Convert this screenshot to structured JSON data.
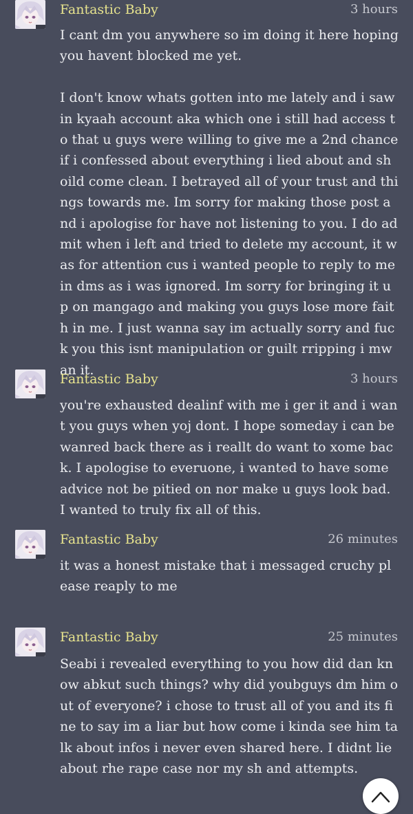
{
  "comments": [
    {
      "user": "Fantastic Baby",
      "time": "3 hours",
      "text": "I cant dm you anywhere so im doing it here hoping you havent blocked me yet.\n\nI don't know whats gotten into me lately and i saw in kyaah account aka which one i still had access to that u guys were willing to give me a 2nd chance if i confessed about everything i lied about and shoild come clean. I betrayed all of your trust and things towards me. Im sorry for making those post and i apologise for have not listening to you. I do admit when i left and tried to delete my account, it was for attention cus i wanted people to reply to me in dms as i was ignored. Im sorry for bringing it up on mangago and making you guys lose more faith in me. I just wanna say im actually sorry and fuck you this isnt manipulation or guilt rripping i mwan it."
    },
    {
      "user": "Fantastic Baby",
      "time": "3 hours",
      "text": "you're exhausted dealinf with me i ger it and i want you guys when yoj dont. I hope someday i can be wanred back there as i reallt do want to xome back. I apologise to everuone, i wanted to have some advice not be pitied on nor make u guys look bad. I wanted to truly fix all of this."
    },
    {
      "user": "Fantastic Baby",
      "time": "26 minutes",
      "text": "it was a honest mistake that i messaged cruchy please reaply to me"
    },
    {
      "user": "Fantastic Baby",
      "time": "25 minutes",
      "text": "Seabi i revealed everything to you how did dan know abkut such things? why did youbguys dm him out of everyone? i chose to trust all of you and its fine to say im a liar but how come i kinda see him talk about infos i never even shared here. I didnt lie about rhe rape case nor my sh and attempts."
    }
  ],
  "icons": {
    "avatar": "anime-avatar-icon",
    "scroll_top": "chevron-up-icon"
  },
  "colors": {
    "background": "#484c5c",
    "username": "#e8e48e",
    "timestamp": "#c6c8cf",
    "text": "#ecedf0"
  }
}
